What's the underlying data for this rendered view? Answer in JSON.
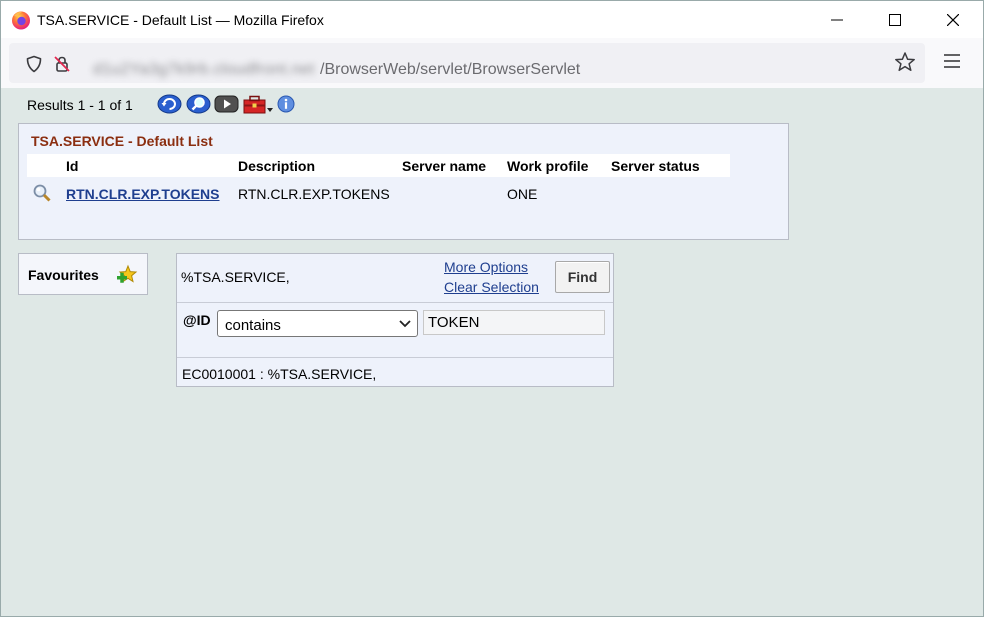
{
  "window": {
    "title": "TSA.SERVICE - Default List — Mozilla Firefox"
  },
  "urlbar": {
    "host": "d1u2Ya3g7k9rb.cloudfront.net",
    "path": "/BrowserWeb/servlet/BrowserServlet"
  },
  "toolbar": {
    "results_text": "Results 1 - 1 of 1"
  },
  "list": {
    "title": "TSA.SERVICE - Default List",
    "columns": [
      "Id",
      "Description",
      "Server name",
      "Work profile",
      "Server status"
    ],
    "rows": [
      {
        "id": "RTN.CLR.EXP.TOKENS",
        "description": "RTN.CLR.EXP.TOKENS",
        "server_name": "",
        "work_profile": "ONE",
        "server_status": ""
      }
    ]
  },
  "favourites": {
    "label": "Favourites"
  },
  "search": {
    "filter_text": "%TSA.SERVICE,",
    "more_options": "More Options",
    "clear_selection": "Clear Selection",
    "find_label": "Find",
    "field_label": "@ID",
    "operator": "contains",
    "value": "TOKEN",
    "status": "EC0010001 : %TSA.SERVICE,"
  },
  "colors": {
    "content_bg": "#dfe8e6",
    "panel_bg": "#eef2fb",
    "list_title": "#8b2e10",
    "link": "#1f3f8f"
  }
}
